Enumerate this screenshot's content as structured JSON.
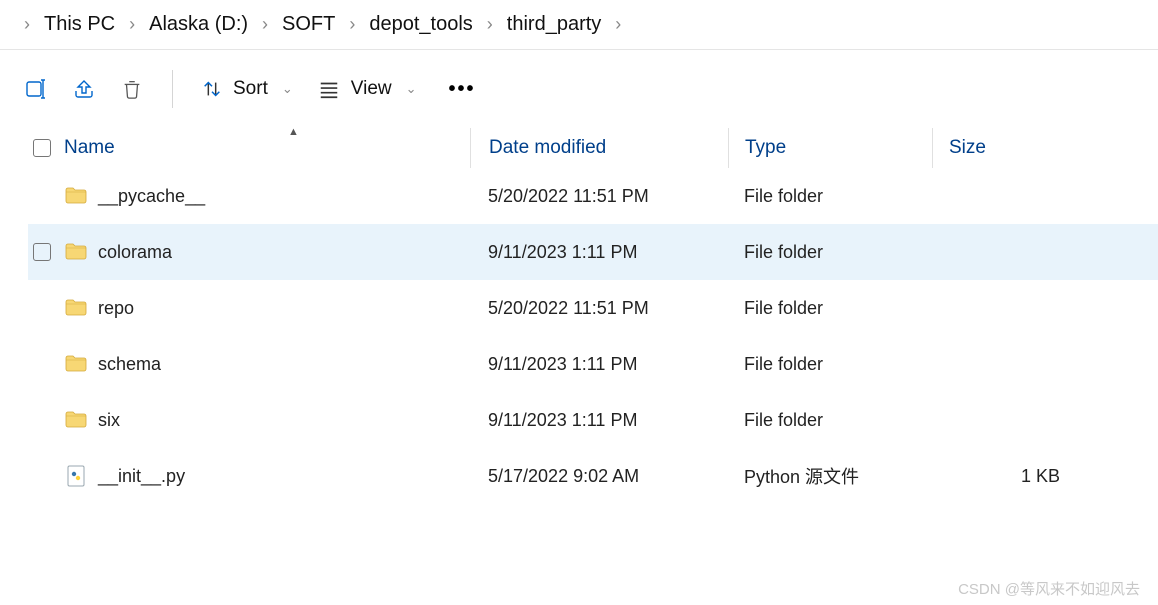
{
  "breadcrumb": [
    "This PC",
    "Alaska (D:)",
    "SOFT",
    "depot_tools",
    "third_party"
  ],
  "toolbar": {
    "sort_label": "Sort",
    "view_label": "View"
  },
  "columns": {
    "name": "Name",
    "date": "Date modified",
    "type": "Type",
    "size": "Size"
  },
  "rows": [
    {
      "icon": "folder",
      "name": "__pycache__",
      "date": "5/20/2022 11:51 PM",
      "type": "File folder",
      "size": "",
      "hovered": false
    },
    {
      "icon": "folder",
      "name": "colorama",
      "date": "9/11/2023 1:11 PM",
      "type": "File folder",
      "size": "",
      "hovered": true
    },
    {
      "icon": "folder",
      "name": "repo",
      "date": "5/20/2022 11:51 PM",
      "type": "File folder",
      "size": "",
      "hovered": false
    },
    {
      "icon": "folder",
      "name": "schema",
      "date": "9/11/2023 1:11 PM",
      "type": "File folder",
      "size": "",
      "hovered": false
    },
    {
      "icon": "folder",
      "name": "six",
      "date": "9/11/2023 1:11 PM",
      "type": "File folder",
      "size": "",
      "hovered": false
    },
    {
      "icon": "py",
      "name": "__init__.py",
      "date": "5/17/2022 9:02 AM",
      "type": "Python 源文件",
      "size": "1 KB",
      "hovered": false
    }
  ],
  "watermark": "CSDN @等风来不如迎风去"
}
